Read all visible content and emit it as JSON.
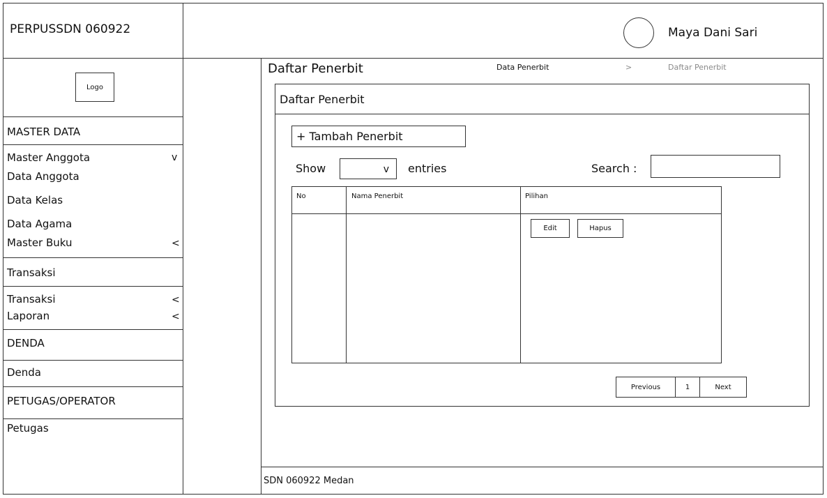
{
  "brand": {
    "title": "PERPUSSDN 060922",
    "logo_label": "Logo"
  },
  "user": {
    "name": "Maya Dani Sari"
  },
  "sidebar": {
    "sections": [
      {
        "title": "MASTER DATA"
      },
      {
        "title": "Transaksi"
      },
      {
        "title": "DENDA"
      },
      {
        "title": "PETUGAS/OPERATOR"
      }
    ],
    "items": [
      {
        "label": "Master Anggota",
        "indicator": "v"
      },
      {
        "label": "Data Anggota",
        "indicator": ""
      },
      {
        "label": "Data Kelas",
        "indicator": ""
      },
      {
        "label": "Data Agama",
        "indicator": ""
      },
      {
        "label": "Master Buku",
        "indicator": "<"
      },
      {
        "label": "Transaksi",
        "indicator": "<"
      },
      {
        "label": "Laporan",
        "indicator": "<"
      },
      {
        "label": "Denda",
        "indicator": ""
      },
      {
        "label": "Petugas",
        "indicator": ""
      }
    ]
  },
  "page": {
    "title": "Daftar Penerbit",
    "breadcrumb": {
      "parent": "Data Penerbit",
      "separator": ">",
      "current": "Daftar Penerbit"
    },
    "panel_title": "Daftar Penerbit",
    "add_button": "+ Tambah Penerbit",
    "show_label": "Show",
    "entries_select": "v",
    "entries_label": "entries",
    "search_label": "Search :",
    "search_value": ""
  },
  "table": {
    "columns": [
      "No",
      "Nama Penerbit",
      "Pilihan"
    ],
    "row_actions": {
      "edit": "Edit",
      "delete": "Hapus"
    }
  },
  "pagination": {
    "previous": "Previous",
    "page": "1",
    "next": "Next"
  },
  "footer": {
    "text": "SDN 060922 Medan"
  }
}
